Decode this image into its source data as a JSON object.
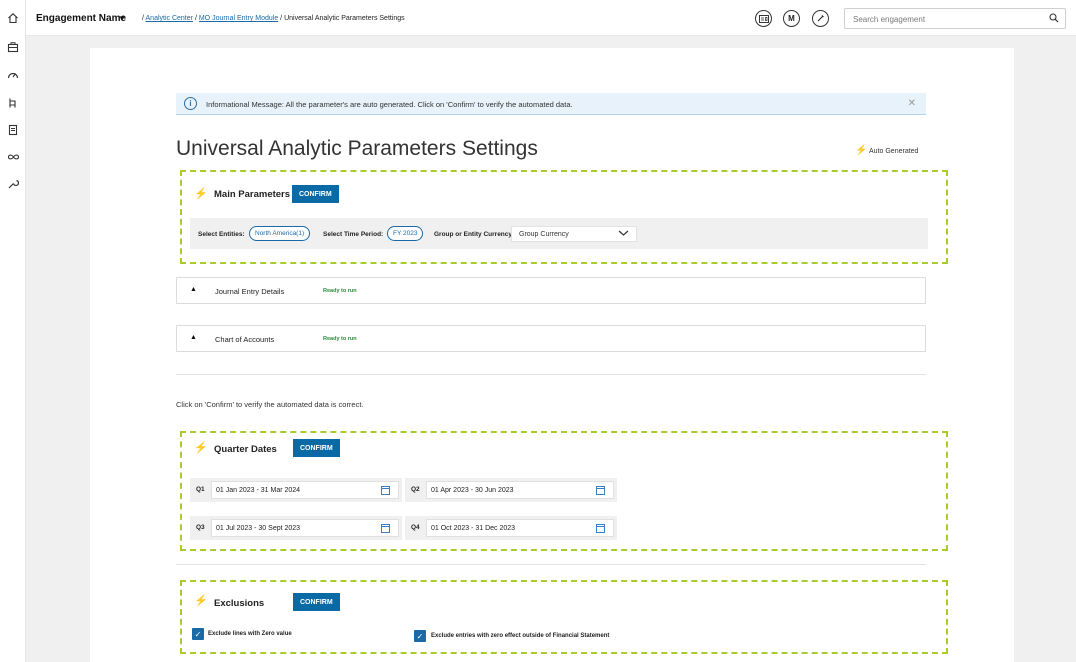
{
  "topbar": {
    "engagement_name": "Engagement Name",
    "breadcrumb": {
      "sep": "/",
      "link1": "Analytic Center",
      "link2": "MO Journal Entry Module",
      "current": "Universal Analytic Parameters Settings"
    },
    "avatar_initial": "M",
    "search_placeholder": "Search engagement"
  },
  "info": {
    "message": "Informational Message: All the parameter's are auto generated. Click on 'Confirm' to verify the automated data."
  },
  "page": {
    "title": "Universal Analytic Parameters Settings",
    "auto_generated_label": "Auto Generated"
  },
  "main_parameters": {
    "title": "Main Parameters",
    "confirm": "CONFIRM",
    "entities_label": "Select Entities:",
    "entities_value": "North America(1)",
    "time_label": "Select Time Period:",
    "time_value": "FY 2023",
    "currency_label": "Group or Entity Currency",
    "currency_value": "Group Currency"
  },
  "accordions": [
    {
      "title": "Journal Entry Details",
      "status": "Ready to run"
    },
    {
      "title": "Chart of Accounts",
      "status": "Ready to run"
    }
  ],
  "note": "Click on 'Confirm' to verify the automated data is correct.",
  "quarter_dates": {
    "title": "Quarter Dates",
    "confirm": "CONFIRM",
    "quarters": [
      {
        "label": "Q1",
        "value": "01 Jan 2023 - 31 Mar 2024"
      },
      {
        "label": "Q2",
        "value": "01 Apr 2023 - 30 Jun 2023"
      },
      {
        "label": "Q3",
        "value": "01 Jul 2023 - 30 Sept 2023"
      },
      {
        "label": "Q4",
        "value": "01 Oct 2023 - 31 Dec 2023"
      }
    ]
  },
  "exclusions": {
    "title": "Exclusions",
    "confirm": "CONFIRM",
    "options": [
      {
        "label": "Exclude lines with Zero value",
        "checked": true
      },
      {
        "label": "Exclude entries with zero effect outside of Financial Statement",
        "checked": true
      }
    ]
  },
  "colors": {
    "accent": "#0a6aa6",
    "dash_border": "#a8cc2e",
    "ready_status": "#2e8b3a"
  },
  "icons": [
    "home-icon",
    "briefcase-icon",
    "gauge-icon",
    "hierarchy-icon",
    "document-icon",
    "infinity-icon",
    "wrench-icon",
    "id-card-icon",
    "edit-icon",
    "search-icon",
    "info-icon",
    "close-icon",
    "magic-wand-icon",
    "calendar-icon",
    "checkbox-icon"
  ]
}
